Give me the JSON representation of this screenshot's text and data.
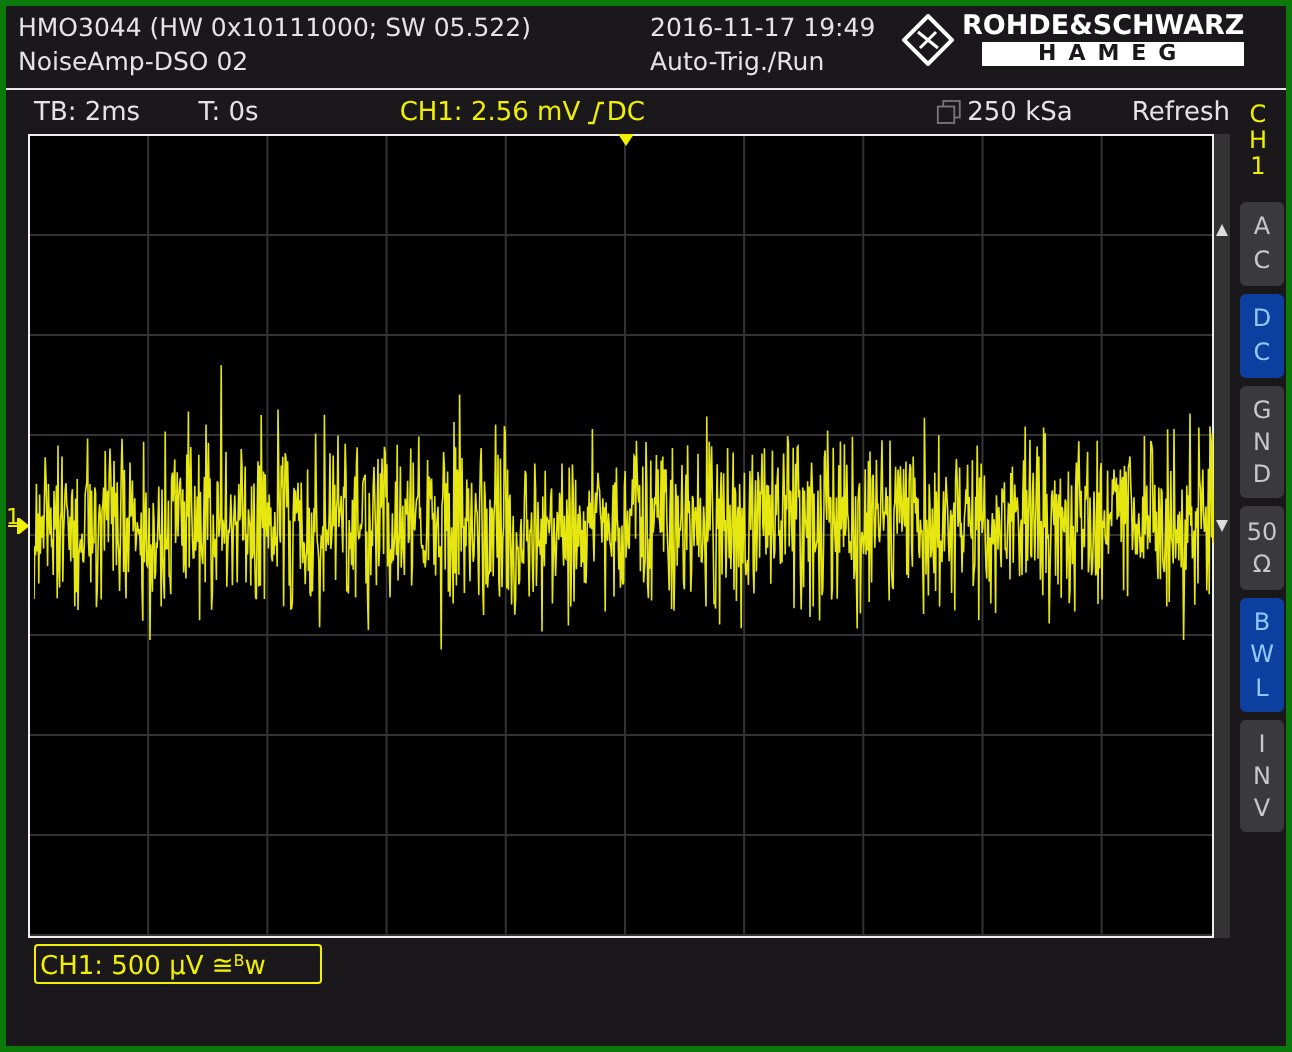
{
  "header": {
    "device": "HMO3044 (HW 0x10111000; SW 05.522)",
    "setup": "NoiseAmp-DSO 02",
    "datetime": "2016-11-17 19:49",
    "trigger_status": "Auto-Trig./Run",
    "brand": "ROHDE&SCHWARZ",
    "sub_brand": "HAMEG"
  },
  "status": {
    "timebase": "TB: 2ms",
    "trigger_time": "T: 0s",
    "channel_reading": "CH1: 2.56 mV",
    "coupling": "DC",
    "sample_rate": "250 kSa",
    "mode": "Refresh"
  },
  "side_panel": {
    "channel": "CH1",
    "buttons": [
      {
        "label": "AC",
        "kind": "letters",
        "on": false
      },
      {
        "label": "DC",
        "kind": "letters",
        "on": true
      },
      {
        "label": "GND",
        "kind": "letters",
        "on": false
      },
      {
        "label": "50 Ω",
        "kind": "words",
        "on": false
      },
      {
        "label": "BWL",
        "kind": "letters",
        "on": true
      },
      {
        "label": "INV",
        "kind": "letters",
        "on": false
      }
    ]
  },
  "channel_marker": "1",
  "scale_label": "CH1: 500 µV ≅$^{B}$w"
}
